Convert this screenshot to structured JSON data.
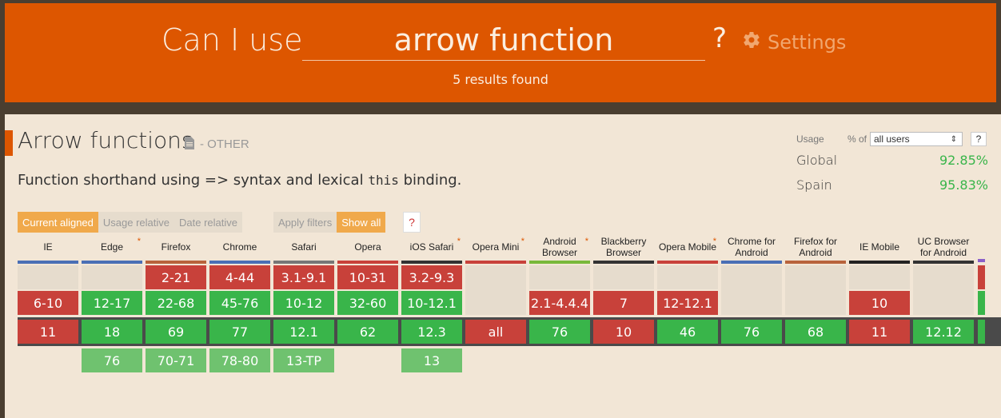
{
  "header": {
    "prefix": "Can I use",
    "search_value": "arrow function",
    "question_mark": "?",
    "settings_label": "Settings",
    "results": "5 results found"
  },
  "feature": {
    "title": "Arrow functions",
    "category": "- OTHER",
    "desc_before": "Function shorthand using => syntax and lexical ",
    "desc_code": "this",
    "desc_after": " binding."
  },
  "usage": {
    "label": "Usage",
    "pct_of": "% of",
    "select_value": "all users",
    "help": "?",
    "rows": [
      {
        "name": "Global",
        "value": "92.85%"
      },
      {
        "name": "Spain",
        "value": "95.83%"
      }
    ]
  },
  "toolbar": {
    "current_aligned": "Current aligned",
    "usage_relative": "Usage relative",
    "date_relative": "Date relative",
    "apply_filters": "Apply filters",
    "show_all": "Show all",
    "help": "?"
  },
  "colors": {
    "brand": "#dd5600",
    "supported": "#39b54a",
    "unsupported": "#c8413a",
    "future": "#6fc26f"
  },
  "browsers": [
    {
      "name": "IE",
      "star": false,
      "line": "#4a6fb5",
      "rows": [
        [
          "",
          "empty"
        ],
        [
          "6-10",
          "n"
        ],
        [
          "11",
          "n"
        ],
        null
      ]
    },
    {
      "name": "Edge",
      "star": true,
      "line": "#4a6fb5",
      "rows": [
        [
          "",
          "empty"
        ],
        [
          "12-17",
          "y"
        ],
        [
          "18",
          "y"
        ],
        [
          "76",
          "f"
        ]
      ]
    },
    {
      "name": "Firefox",
      "star": false,
      "line": "#b8633c",
      "rows": [
        [
          "2-21",
          "n"
        ],
        [
          "22-68",
          "y"
        ],
        [
          "69",
          "y"
        ],
        [
          "70-71",
          "f"
        ]
      ]
    },
    {
      "name": "Chrome",
      "star": false,
      "line": "#4a6fb5",
      "rows": [
        [
          "4-44",
          "n"
        ],
        [
          "45-76",
          "y"
        ],
        [
          "77",
          "y"
        ],
        [
          "78-80",
          "f"
        ]
      ]
    },
    {
      "name": "Safari",
      "star": false,
      "line": "#777777",
      "rows": [
        [
          "3.1-9.1",
          "n"
        ],
        [
          "10-12",
          "y"
        ],
        [
          "12.1",
          "y"
        ],
        [
          "13-TP",
          "f"
        ]
      ]
    },
    {
      "name": "Opera",
      "star": false,
      "line": "#c8413a",
      "rows": [
        [
          "10-31",
          "n"
        ],
        [
          "32-60",
          "y"
        ],
        [
          "62",
          "y"
        ],
        null
      ]
    },
    {
      "name": "iOS Safari",
      "star": true,
      "line": "#333333",
      "rows": [
        [
          "3.2-9.3",
          "n"
        ],
        [
          "10-12.1",
          "y"
        ],
        [
          "12.3",
          "y"
        ],
        [
          "13",
          "f"
        ]
      ]
    },
    {
      "name": "Opera Mini",
      "star": true,
      "line": "#c8413a",
      "rows": [
        [
          "",
          "empty2"
        ],
        null,
        [
          "all",
          "n"
        ],
        null
      ]
    },
    {
      "name": "Android Browser",
      "star": true,
      "line": "#78b83a",
      "rows": [
        [
          "",
          "empty"
        ],
        [
          "2.1-4.4.4",
          "n"
        ],
        [
          "76",
          "y"
        ],
        null
      ]
    },
    {
      "name": "Blackberry Browser",
      "star": false,
      "line": "#333333",
      "rows": [
        [
          "",
          "empty"
        ],
        [
          "7",
          "n"
        ],
        [
          "10",
          "n"
        ],
        null
      ]
    },
    {
      "name": "Opera Mobile",
      "star": true,
      "line": "#c8413a",
      "rows": [
        [
          "",
          "empty"
        ],
        [
          "12-12.1",
          "n"
        ],
        [
          "46",
          "y"
        ],
        null
      ]
    },
    {
      "name": "Chrome for Android",
      "star": false,
      "line": "#4a6fb5",
      "rows": [
        [
          "",
          "empty2"
        ],
        null,
        [
          "76",
          "y"
        ],
        null
      ]
    },
    {
      "name": "Firefox for Android",
      "star": false,
      "line": "#b8633c",
      "rows": [
        [
          "",
          "empty2"
        ],
        null,
        [
          "68",
          "y"
        ],
        null
      ]
    },
    {
      "name": "IE Mobile",
      "star": false,
      "line": "#222222",
      "rows": [
        [
          "",
          "empty"
        ],
        [
          "10",
          "n"
        ],
        [
          "11",
          "n"
        ],
        null
      ]
    },
    {
      "name": "UC Browser for Android",
      "star": false,
      "line": "#333333",
      "rows": [
        [
          "",
          "empty2"
        ],
        null,
        [
          "12.12",
          "y"
        ],
        null
      ]
    }
  ]
}
